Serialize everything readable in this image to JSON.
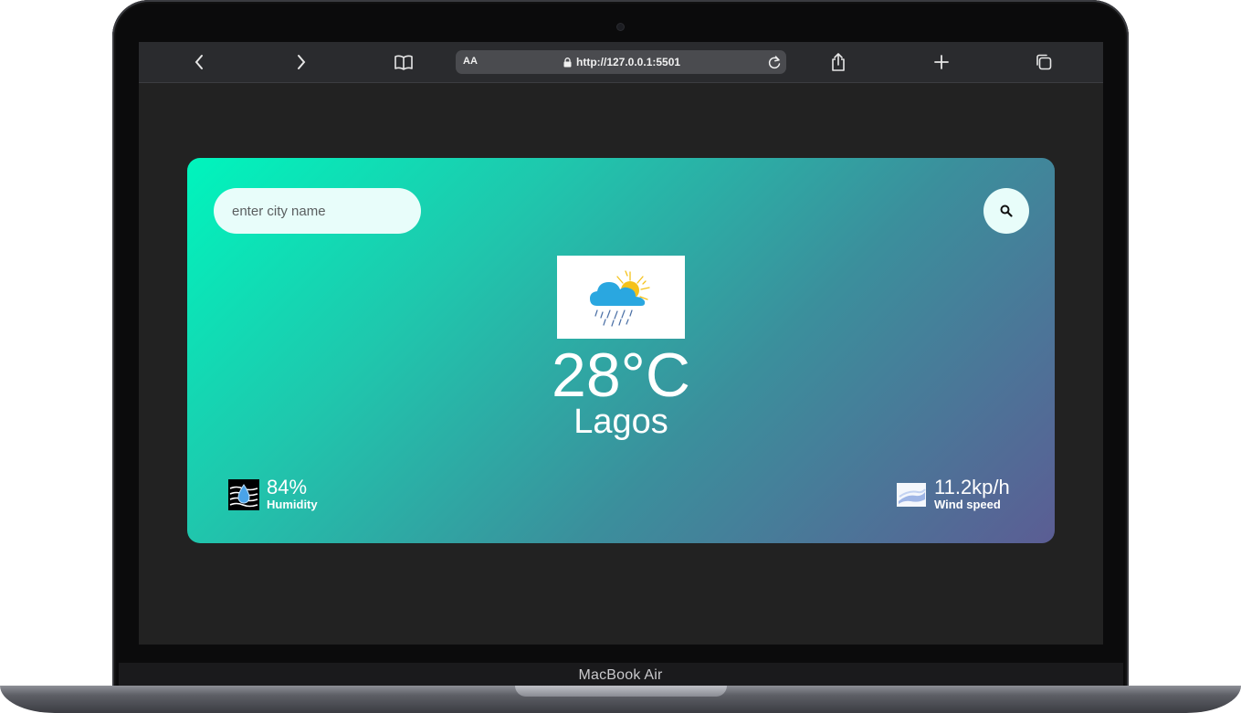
{
  "device": {
    "label": "MacBook Air"
  },
  "browser": {
    "address_prefix": "AA",
    "url": "http://127.0.0.1:5501",
    "icons": [
      "chevron-left-icon",
      "chevron-right-icon",
      "book-icon",
      "lock-icon",
      "reload-icon",
      "share-icon",
      "plus-icon",
      "tabs-icon"
    ]
  },
  "weather": {
    "search": {
      "placeholder": "enter city name",
      "value": ""
    },
    "icon": "rain-cloud-sun-icon",
    "temperature": "28°C",
    "city": "Lagos",
    "humidity": {
      "value": "84%",
      "label": "Humidity"
    },
    "wind": {
      "value": "11.2kp/h",
      "label": "Wind speed"
    },
    "colors": {
      "gradient_start": "#00f5bd",
      "gradient_end": "#5b5d94",
      "input_bg": "#e8fdfa"
    }
  }
}
